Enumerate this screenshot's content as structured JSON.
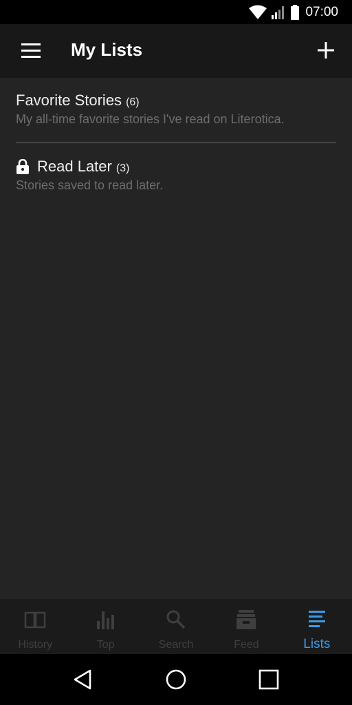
{
  "status_bar": {
    "time": "07:00"
  },
  "app_bar": {
    "title": "My Lists"
  },
  "lists": [
    {
      "title": "Favorite Stories",
      "count": "(6)",
      "description": "My all-time favorite stories I've read on Literotica.",
      "locked": false
    },
    {
      "title": "Read Later",
      "count": "(3)",
      "description": "Stories saved to read later.",
      "locked": true
    }
  ],
  "bottom_nav": {
    "items": [
      {
        "label": "History",
        "icon": "book-icon",
        "active": false
      },
      {
        "label": "Top",
        "icon": "bar-chart-icon",
        "active": false
      },
      {
        "label": "Search",
        "icon": "search-icon",
        "active": false
      },
      {
        "label": "Feed",
        "icon": "inbox-icon",
        "active": false
      },
      {
        "label": "Lists",
        "icon": "list-icon",
        "active": true
      }
    ]
  },
  "colors": {
    "accent": "#3d9be9",
    "background": "#242424",
    "app_bar": "#181818",
    "inactive_nav": "#3f3f3f"
  }
}
